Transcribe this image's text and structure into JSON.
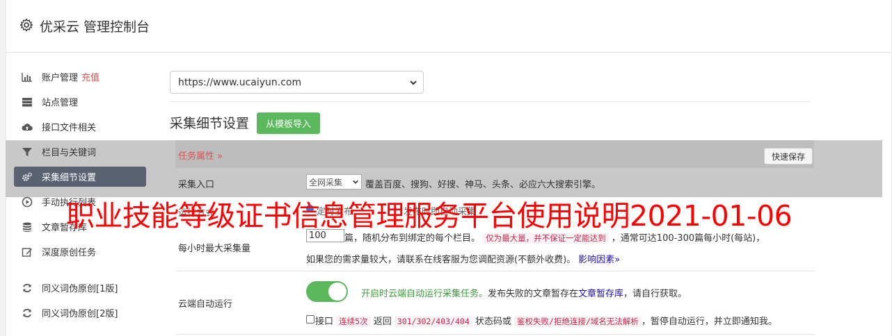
{
  "header": {
    "title": "优采云 管理控制台"
  },
  "sidebar": {
    "items": [
      {
        "label": "账户管理",
        "extra": "充值",
        "icon": "bar-chart-icon"
      },
      {
        "label": "站点管理",
        "icon": "server-icon"
      },
      {
        "label": "接口文件相关",
        "icon": "cloud-upload-icon"
      },
      {
        "label": "栏目与关键词",
        "icon": "filter-icon"
      },
      {
        "label": "采集细节设置",
        "icon": "gears-icon",
        "active": true
      },
      {
        "label": "手动执行列表",
        "icon": "play-circle-icon"
      },
      {
        "label": "文章暂存库",
        "icon": "database-icon"
      },
      {
        "label": "深度原创任务",
        "icon": "edit-icon"
      },
      {
        "label": "同义词伪原创[1版]",
        "icon": "refresh-icon"
      },
      {
        "label": "同义词伪原创[2版]",
        "icon": "refresh-icon"
      }
    ]
  },
  "site_select": {
    "value": "https://www.ucaiyun.com"
  },
  "section": {
    "title": "采集细节设置",
    "import_button": "从模板导入"
  },
  "tab": {
    "label": "任务属性 »",
    "quick_save": "快速保存"
  },
  "collect_entry": {
    "label": "采集入口",
    "select_value": "全网采集",
    "desc": "覆盖百度、搜狗、好搜、神马、头条、必应六大搜索引擎。"
  },
  "row2": {
    "label": "运行方式",
    "radio_text": "定时发布",
    "radio_text2": "发布时即自动采集"
  },
  "max_collect": {
    "label": "每小时最大采集量",
    "input_value": "100",
    "text1": "篇，随机分布到绑定的每个栏目。",
    "code1": "仅为最大量，并不保证一定能达到",
    "text2": "，通常可达100-300篇每小时(每站)，",
    "text3": "如果您的需求量较大，请联系在线客服为您调配资源(不额外收费)。",
    "link": "影响因素»"
  },
  "cloud_run": {
    "label": "云端自动运行",
    "toggle_text": "开启时云端自动运行采集任务。",
    "text_a": "发布失败的文章暂存在",
    "link": "文章暂存库",
    "text_b": "，请自行获取。",
    "chk_label": "接口",
    "code1": "连续5次",
    "t1": "返回",
    "code2": "301/302/403/404",
    "t2": "状态码或",
    "code3": "鉴权失败/拒绝连接/域名无法解析",
    "t3": "，暂停自动运行，并立即通知我。"
  },
  "overlay": {
    "text": "职业技能等级证书信息管理服务平台使用说明2021-01-06"
  },
  "colors": {
    "accent_green": "#5cb85c",
    "active_nav": "#5a6170",
    "danger": "#d9534f",
    "overlay": "#ff0000"
  }
}
